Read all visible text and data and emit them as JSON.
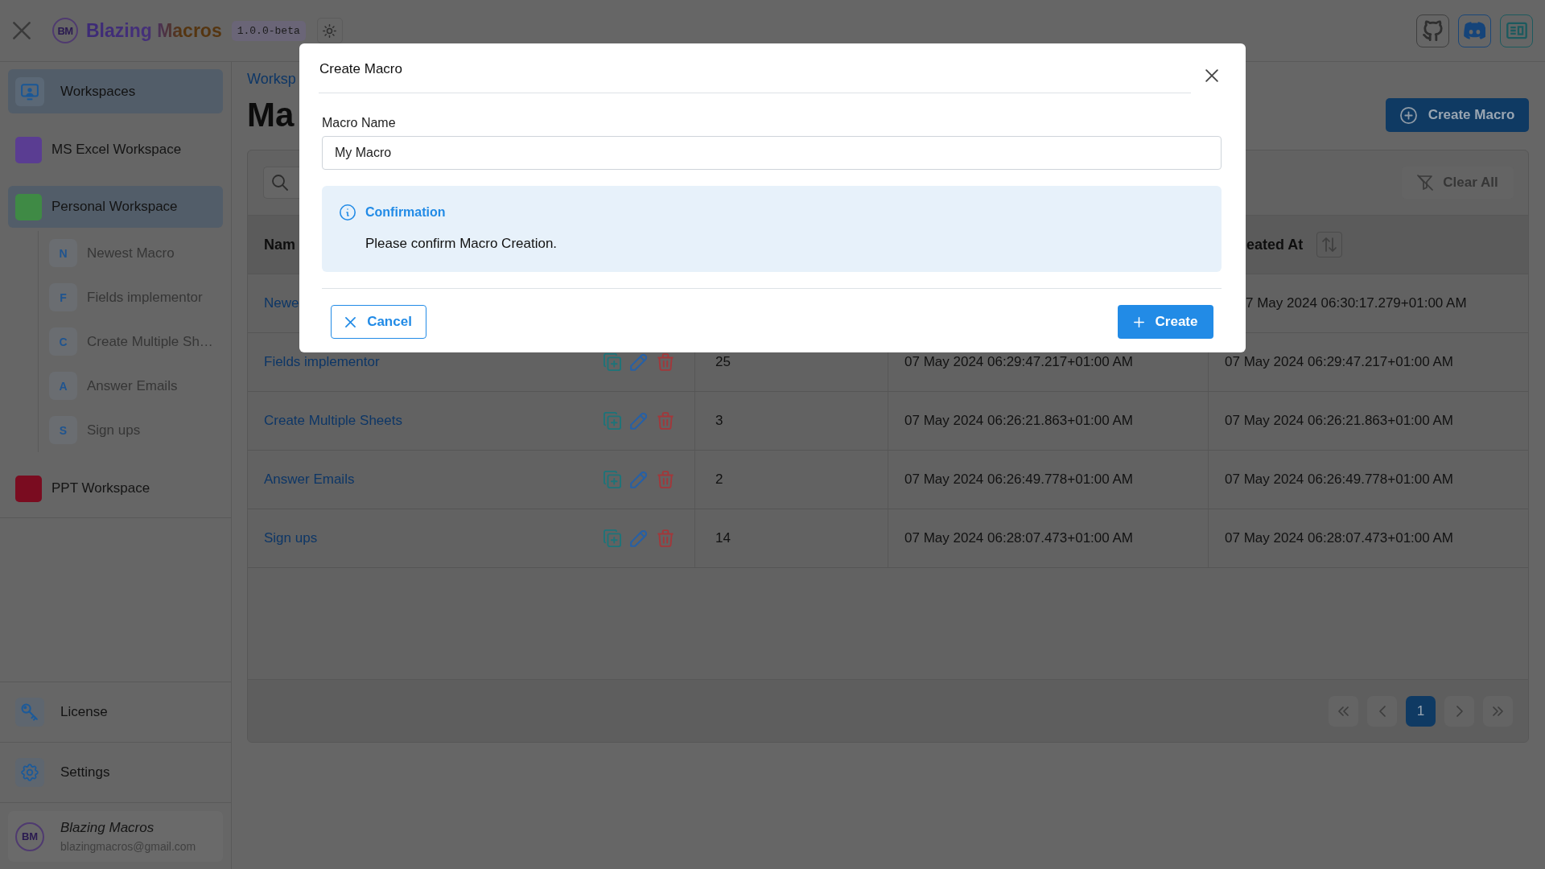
{
  "app_bar": {
    "logo_text": "BM",
    "title": "Blazing Macros",
    "version": "1.0.0-beta"
  },
  "sidebar": {
    "nav_item": {
      "label": "Workspaces",
      "selected": true
    },
    "workspaces": [
      {
        "name": "MS Excel Workspace",
        "color": "#5a3d92",
        "selected": false
      },
      {
        "name": "Personal Workspace",
        "color": "#3f8a45",
        "selected": true,
        "children": [
          {
            "initial": "N",
            "name": "Newest Macro"
          },
          {
            "initial": "F",
            "name": "Fields implementor"
          },
          {
            "initial": "C",
            "name": "Create Multiple Sh…"
          },
          {
            "initial": "A",
            "name": "Answer Emails"
          },
          {
            "initial": "S",
            "name": "Sign ups"
          }
        ]
      },
      {
        "name": "PPT Workspace",
        "color": "#7a0c20",
        "selected": false
      }
    ],
    "bottom_items": [
      {
        "kind": "license",
        "label": "License"
      },
      {
        "kind": "settings",
        "label": "Settings"
      }
    ],
    "user": {
      "avatar_text": "BM",
      "name": "Blazing Macros",
      "email": "blazingmacros@gmail.com"
    }
  },
  "main": {
    "breadcrumb": "Worksp",
    "title": "Ma",
    "create_button": "Create Macro",
    "clear_button": "Clear All",
    "table": {
      "header": {
        "column_1": "Nam",
        "column_4": "eated At"
      },
      "rows": [
        {
          "column_1": "Newe",
          "column_4": "7 May 2024 06:30:17.279+01:00 AM"
        },
        {
          "column_1": "Fields implementor",
          "actions": true,
          "column_2": "25",
          "column_3": "07 May 2024 06:29:47.217+01:00 AM",
          "column_4": "07 May 2024 06:29:47.217+01:00 AM"
        },
        {
          "column_1": "Create Multiple Sheets",
          "actions": true,
          "column_2": "3",
          "column_3": "07 May 2024 06:26:21.863+01:00 AM",
          "column_4": "07 May 2024 06:26:21.863+01:00 AM"
        },
        {
          "column_1": "Answer Emails",
          "actions": true,
          "column_2": "2",
          "column_3": "07 May 2024 06:26:49.778+01:00 AM",
          "column_4": "07 May 2024 06:26:49.778+01:00 AM"
        },
        {
          "column_1": "Sign ups",
          "actions": true,
          "column_2": "14",
          "column_3": "07 May 2024 06:28:07.473+01:00 AM",
          "column_4": "07 May 2024 06:28:07.473+01:00 AM"
        }
      ]
    },
    "pagination": {
      "pages": [
        {
          "label": "1",
          "selected": true
        }
      ]
    }
  },
  "dialog": {
    "title": "Create Macro",
    "field": {
      "label": "Macro Name",
      "value": "My Macro"
    },
    "alert": {
      "title": "Confirmation",
      "message": "Please confirm Macro Creation."
    },
    "buttons": [
      {
        "kind": "cancel",
        "label": "Cancel"
      },
      {
        "kind": "create",
        "label": "Create"
      }
    ]
  }
}
